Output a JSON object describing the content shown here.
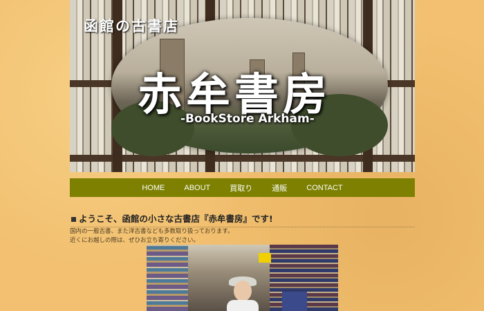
{
  "header": {
    "subtitle": "函館の古書店",
    "title": "赤牟書房",
    "title_en": "-BookStore Arkham-"
  },
  "nav": {
    "items": [
      "HOME",
      "ABOUT",
      "買取り",
      "通販",
      "CONTACT"
    ]
  },
  "main": {
    "heading": "ようこそ、函館の小さな古書店『赤牟書房』です!",
    "intro_lines": [
      "国内の一般古書、また洋古書なども多数取り扱っております。",
      "近くにお越しの際は、ぜひお立ち寄りください。"
    ]
  }
}
